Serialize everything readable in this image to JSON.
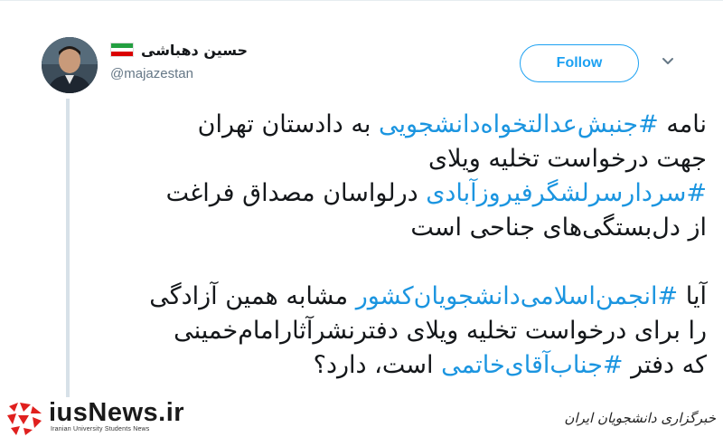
{
  "author": {
    "name": "حسین دهباشی",
    "handle": "@majazestan"
  },
  "follow_label": "Follow",
  "colors": {
    "accent": "#1da1f2",
    "hashtag": "#1b95e0",
    "thread_line": "#d7e1e8"
  },
  "tweet": {
    "l1_pre": "نامه ",
    "l1_tag": "#جنبش‌عدالتخواه‌دانشجویی",
    "l1_post": " به دادستان تهران",
    "l2": "جهت درخواست تخلیه ویلای",
    "l3_tag": "#سردارسرلشگرفیروزآبادی",
    "l3_post": " درلواسان مصداق فراغت",
    "l4": "از دل‌بستگی‌های جناحی است",
    "l5_pre": "آیا ",
    "l5_tag": "#انجمن‌اسلامی‌دانشجویان‌کشور",
    "l5_post": " مشابه همین آزادگی",
    "l6": "را برای درخواست تخلیه ویلای دفترنشرآثارامام‌خمینی",
    "l7_pre": "که دفتر ",
    "l7_tag": "#جناب‌آقای‌خاتمی",
    "l7_post": " است، دارد؟"
  },
  "watermark": {
    "brand": "iusNews.ir",
    "sub": "Iranian University Students News",
    "fa": "خبرگزاری دانشجویان ایران"
  }
}
